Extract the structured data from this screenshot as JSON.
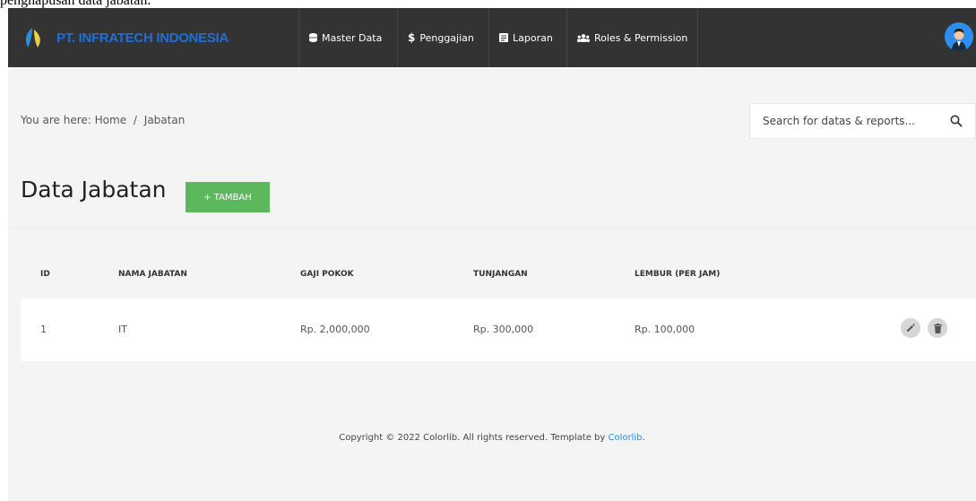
{
  "caption": "penghapusan data jabatan.",
  "navbar": {
    "brand": "PT. INFRATECH INDONESIA",
    "items": [
      {
        "label": "Master Data",
        "icon": "database-icon"
      },
      {
        "label": "Penggajian",
        "icon": "dollar-icon"
      },
      {
        "label": "Laporan",
        "icon": "report-icon"
      },
      {
        "label": "Roles & Permission",
        "icon": "users-icon"
      }
    ]
  },
  "breadcrumb": {
    "prefix": "You are here:",
    "home": "Home",
    "separator": "/",
    "current": "Jabatan"
  },
  "search": {
    "placeholder": "Search for datas & reports..."
  },
  "page": {
    "title": "Data Jabatan",
    "add_label": "+ TAMBAH"
  },
  "table": {
    "headers": [
      "ID",
      "NAMA JABATAN",
      "GAJI POKOK",
      "TUNJANGAN",
      "LEMBUR (PER JAM)"
    ],
    "rows": [
      {
        "id": "1",
        "nama": "IT",
        "gaji": "Rp. 2,000,000",
        "tunjangan": "Rp. 300,000",
        "lembur": "Rp. 100,000"
      }
    ]
  },
  "footer": {
    "text": "Copyright © 2022 Colorlib. All rights reserved. Template by",
    "link": "Colorlib",
    "suffix": "."
  },
  "colors": {
    "navbar": "#333333",
    "brand": "#1e6fd9",
    "add_button": "#5cb85c",
    "link": "#1e90ff"
  }
}
